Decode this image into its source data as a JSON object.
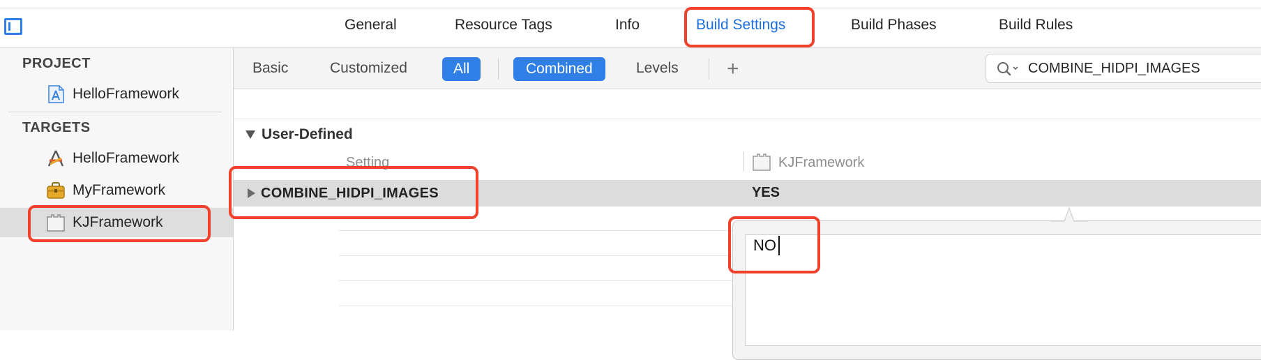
{
  "tabs": [
    {
      "label": "General"
    },
    {
      "label": "Resource Tags"
    },
    {
      "label": "Info"
    },
    {
      "label": "Build Settings",
      "active": true
    },
    {
      "label": "Build Phases"
    },
    {
      "label": "Build Rules"
    }
  ],
  "sidebar": {
    "project_title": "PROJECT",
    "project_items": [
      {
        "label": "HelloFramework",
        "icon": "project-blueprint-icon"
      }
    ],
    "targets_title": "TARGETS",
    "target_items": [
      {
        "label": "HelloFramework",
        "icon": "app-target-icon"
      },
      {
        "label": "MyFramework",
        "icon": "toolbox-icon"
      },
      {
        "label": "KJFramework",
        "icon": "framework-icon",
        "selected": true
      }
    ]
  },
  "filter": {
    "basic": "Basic",
    "customized": "Customized",
    "all": "All",
    "combined": "Combined",
    "levels": "Levels",
    "add": "+",
    "search_value": "COMBINE_HIDPI_IMAGES"
  },
  "settings": {
    "group_title": "User-Defined",
    "column_setting": "Setting",
    "column_target": "KJFramework",
    "rows": [
      {
        "name": "COMBINE_HIDPI_IMAGES",
        "value": "YES"
      }
    ]
  },
  "editor": {
    "value": "NO"
  },
  "colors": {
    "accent": "#2f7fe6",
    "highlight": "#f0412c",
    "selected_row": "#dcdcdc"
  }
}
